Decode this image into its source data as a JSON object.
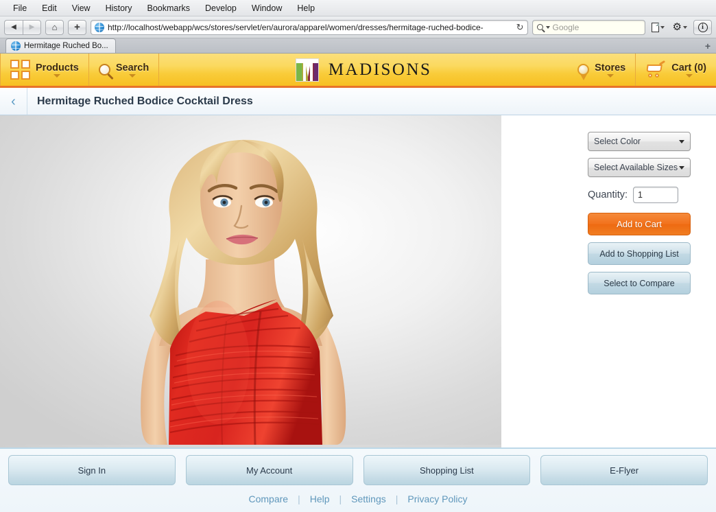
{
  "browser": {
    "menu_items": [
      "File",
      "Edit",
      "View",
      "History",
      "Bookmarks",
      "Develop",
      "Window",
      "Help"
    ],
    "nav": {
      "back_icon": "back-arrow-icon",
      "forward_icon": "forward-arrow-icon",
      "home_icon": "home-icon",
      "add_icon": "plus-icon",
      "reload_glyph": "↻"
    },
    "url": "http://localhost/webapp/wcs/stores/servlet/en/aurora/apparel/women/dresses/hermitage-ruched-bodice-",
    "search_placeholder": "Google",
    "toolbar_icons": [
      "page-icon",
      "gear-icon",
      "info-icon"
    ],
    "info_glyph": "i",
    "tab_label": "Hermitage Ruched Bo...",
    "new_tab_glyph": "+"
  },
  "store_header": {
    "products_label": "Products",
    "products_icon": "grid-icon",
    "search_label": "Search",
    "search_icon": "magnifier-icon",
    "brand": "MADISONS",
    "brand_icon": "madisons-m-logo",
    "stores_label": "Stores",
    "stores_icon": "location-pin-icon",
    "cart_label": "Cart (0)",
    "cart_icon": "shopping-cart-icon",
    "colors": {
      "bg_top": "#fbdf7c",
      "bg_bottom": "#f7bf22",
      "accent_rule": "#e8732a"
    }
  },
  "page": {
    "back_icon": "chevron-left-icon",
    "title": "Hermitage Ruched Bodice Cocktail Dress"
  },
  "product": {
    "image_alt": "blonde-model-wearing-red-ruched-cocktail-dress",
    "color_select": "Select Color",
    "size_select": "Select Available Sizes",
    "quantity_label": "Quantity:",
    "quantity_value": "1",
    "add_to_cart": "Add to Cart",
    "add_to_shopping_list": "Add to Shopping List",
    "select_to_compare": "Select to Compare",
    "colors": {
      "cart_button": "#f2731d",
      "secondary_button": "#c2d9e4",
      "dress": "#d8241f"
    }
  },
  "footer": {
    "buttons": [
      "Sign In",
      "My Account",
      "Shopping List",
      "E-Flyer"
    ],
    "links": [
      "Compare",
      "Help",
      "Settings",
      "Privacy Policy"
    ],
    "separator": "|",
    "link_color": "#5f97bb"
  }
}
